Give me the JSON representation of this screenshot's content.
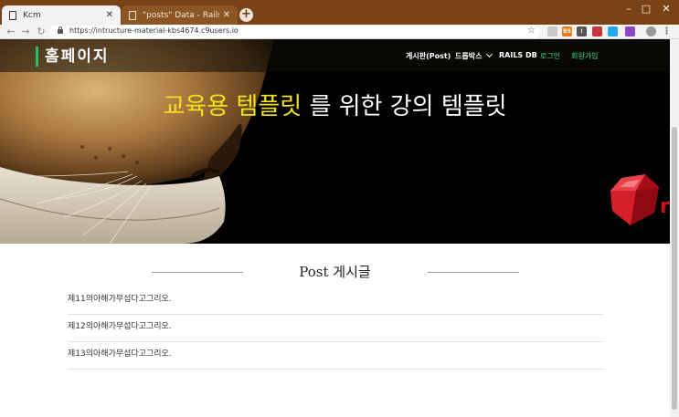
{
  "browser": {
    "tabs": [
      {
        "title": "Kcm",
        "active": true
      },
      {
        "title": "\"posts\" Data - Rails DB",
        "active": false
      }
    ],
    "new_tab": "+",
    "url": "https://intructure-material-kbs4674.c9users.io",
    "window_controls": {
      "minimize": "–",
      "maximize": "□",
      "close": "✕"
    },
    "nav": {
      "back": "←",
      "forward": "→",
      "reload": "↻"
    },
    "star": "☆",
    "extensions": [
      {
        "label": "",
        "color": "#c9c9c9"
      },
      {
        "label": "B5",
        "color": "#e8791b"
      },
      {
        "label": "!",
        "color": "#555555"
      },
      {
        "label": "",
        "color": "#c4343d"
      },
      {
        "label": "",
        "color": "#22a7f0"
      },
      {
        "label": "",
        "color": "#8b45c6"
      }
    ]
  },
  "site": {
    "brand": "홈페이지",
    "nav": {
      "board": "게시판(Post)",
      "dropdown": "드롭박스",
      "rails_db": "RAILS DB",
      "login": "로그인",
      "signup": "회원가입"
    },
    "hero": {
      "title_highlight": "교육용 템플릿",
      "title_rest": " 를 위한 강의 템플릿"
    }
  },
  "posts": {
    "section_title": "Post 게시글",
    "items": [
      "제11의아해가무섭다고그리오.",
      "제12의아해가무섭다고그리오.",
      "제13의아해가무섭다고그리오."
    ]
  },
  "colors": {
    "titlebar": "#7a4315",
    "brand_accent": "#25c26a",
    "highlight_yellow": "#f1e21b",
    "auth_green": "#39e07a"
  }
}
